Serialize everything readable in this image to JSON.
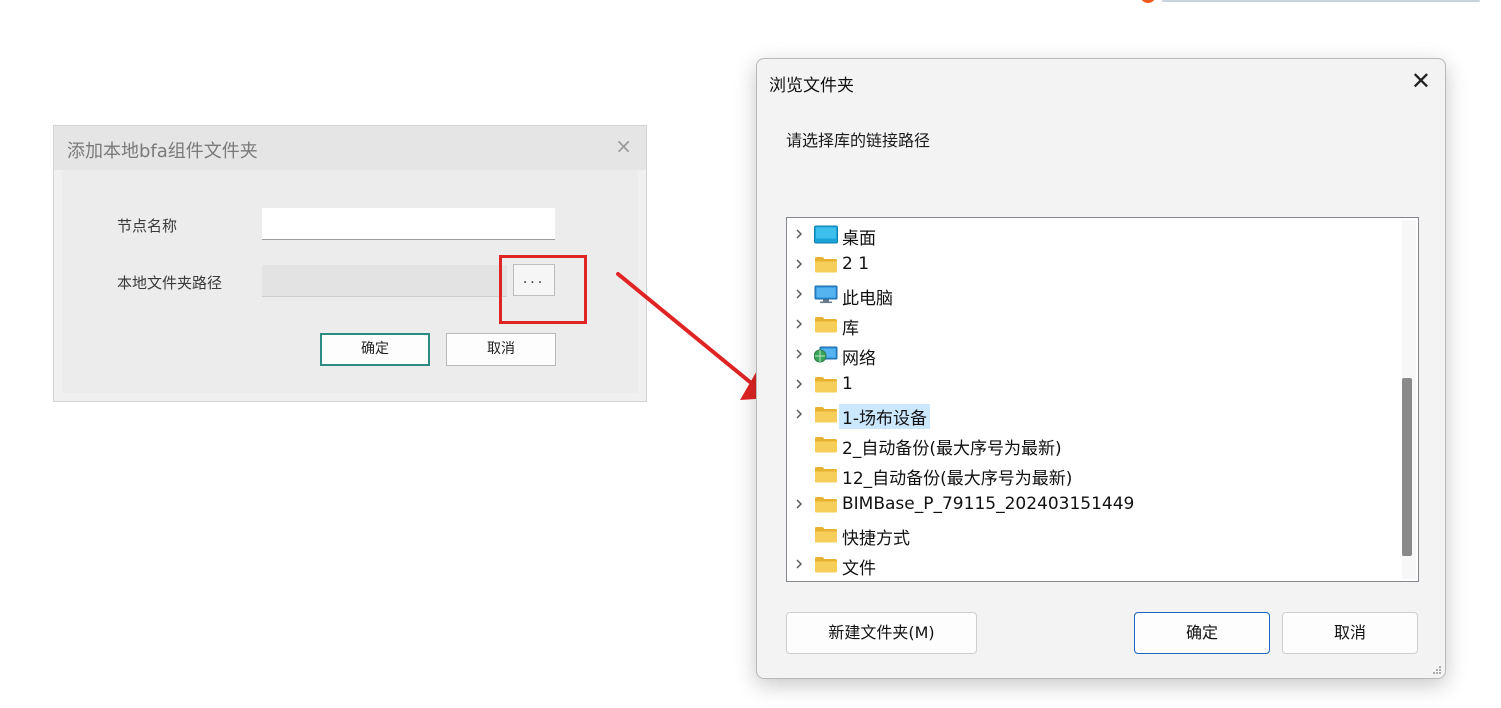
{
  "left_dialog": {
    "title": "添加本地bfa组件文件夹",
    "close_glyph": "×",
    "node_name_label": "节点名称",
    "node_name_value": "",
    "local_path_label": "本地文件夹路径",
    "local_path_value": "",
    "browse_label": "...",
    "ok_label": "确定",
    "cancel_label": "取消"
  },
  "browse_dialog": {
    "title": "浏览文件夹",
    "close_glyph": "✕",
    "prompt": "请选择库的链接路径",
    "tree": [
      {
        "name": "桌面",
        "icon": "desktop-icon",
        "expandable": true,
        "selected": false
      },
      {
        "name": "2 1",
        "icon": "folder-icon",
        "expandable": true,
        "selected": false
      },
      {
        "name": "此电脑",
        "icon": "computer-icon",
        "expandable": true,
        "selected": false
      },
      {
        "name": "库",
        "icon": "folder-icon",
        "expandable": true,
        "selected": false
      },
      {
        "name": "网络",
        "icon": "network-icon",
        "expandable": true,
        "selected": false
      },
      {
        "name": "1",
        "icon": "folder-icon",
        "expandable": true,
        "selected": false
      },
      {
        "name": "1-场布设备",
        "icon": "folder-icon",
        "expandable": true,
        "selected": true
      },
      {
        "name": "2_自动备份(最大序号为最新)",
        "icon": "folder-icon",
        "expandable": false,
        "selected": false
      },
      {
        "name": "12_自动备份(最大序号为最新)",
        "icon": "folder-icon",
        "expandable": false,
        "selected": false
      },
      {
        "name": "BIMBase_P_79115_202403151449",
        "icon": "folder-icon",
        "expandable": true,
        "selected": false
      },
      {
        "name": "快捷方式",
        "icon": "folder-icon",
        "expandable": false,
        "selected": false
      },
      {
        "name": "文件",
        "icon": "folder-icon",
        "expandable": true,
        "selected": false
      }
    ],
    "new_folder_label": "新建文件夹(M)",
    "ok_label": "确定",
    "cancel_label": "取消"
  },
  "colors": {
    "highlight_box": "#e02424",
    "arrow": "#e02424",
    "ok_border_left": "#2a8c83",
    "ok_border_right": "#1a66c2",
    "selection": "#cce8ff",
    "folder": "#f4c542"
  }
}
